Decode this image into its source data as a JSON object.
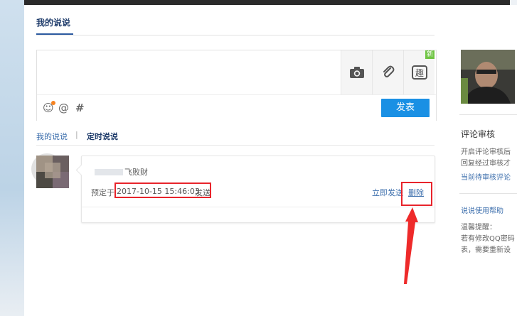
{
  "tabs": {
    "active": "我的说说"
  },
  "composer": {
    "new_badge": "新",
    "publish_label": "发表",
    "tools": [
      "camera-icon",
      "link-icon",
      "fun-icon"
    ]
  },
  "subtabs": {
    "my": "我的说说",
    "separator": "|",
    "timed": "定时说说"
  },
  "post": {
    "content_visible": "飞败财",
    "schedule_prefix": "预定于",
    "schedule_time": "2017-10-15 15:46:03",
    "schedule_suffix": "发送",
    "send_now": "立即发送",
    "delete": "删除"
  },
  "right_panel": {
    "review_title": "评论审核",
    "review_desc_line1": "开启评论审核后",
    "review_desc_line2": "回复经过审核才",
    "review_pending_link": "当前待审核评论",
    "help_link": "说说使用帮助",
    "tip_title": "温馨提醒：",
    "tip_line1": "若有修改QQ密码",
    "tip_line2": "表，需要重新设"
  },
  "colors": {
    "accent": "#1a90e4",
    "link": "#3d6fad",
    "highlight": "#e8242b",
    "badge": "#70c545"
  }
}
